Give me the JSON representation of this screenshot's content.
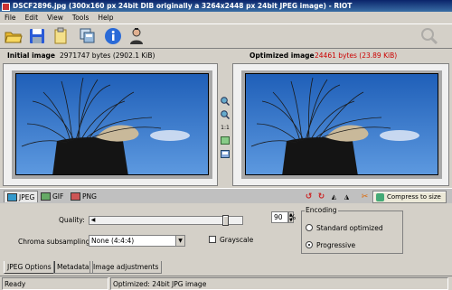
{
  "window": {
    "title": "DSCF2896.jpg (300x160 px 24bit DIB originally a 3264x2448 px 24bit JPEG image) - RIOT"
  },
  "menu": [
    "File",
    "Edit",
    "View",
    "Tools",
    "Help"
  ],
  "toolbar": {
    "icons": [
      "open-folder-icon",
      "save-icon",
      "clipboard-icon",
      "batch-icon",
      "info-icon",
      "user-icon",
      "zoom-icon"
    ]
  },
  "header": {
    "initial_label": "Initial image",
    "initial_size": "2971747 bytes (2902.1 KiB)",
    "optimized_label": "Optimized image",
    "optimized_size": "24461 bytes (23.89 KiB)",
    "optimized_size_color": "#cc0000"
  },
  "middle_buttons": [
    "zoom-in-icon",
    "zoom-out-icon",
    "1:1",
    "fit-icon",
    "compare-icon"
  ],
  "formats": {
    "tabs": [
      "JPEG",
      "GIF",
      "PNG"
    ],
    "selected": "JPEG"
  },
  "compress": {
    "label": "Compress to size"
  },
  "jpeg_options": {
    "quality_label": "Quality:",
    "quality_value": "90",
    "quality_unit": "%",
    "quality_fraction": 0.9,
    "chroma_label": "Chroma subsampling:",
    "chroma_value": "None (4:4:4)",
    "grayscale_label": "Grayscale",
    "grayscale_checked": false,
    "encoding_title": "Encoding",
    "encoding_options": [
      "Standard optimized",
      "Progressive"
    ],
    "encoding_selected": "Progressive"
  },
  "option_tabs": [
    "JPEG Options",
    "Metadata",
    "Image adjustments"
  ],
  "status": {
    "left": "Ready",
    "right": "Optimized: 24bit JPG image"
  }
}
